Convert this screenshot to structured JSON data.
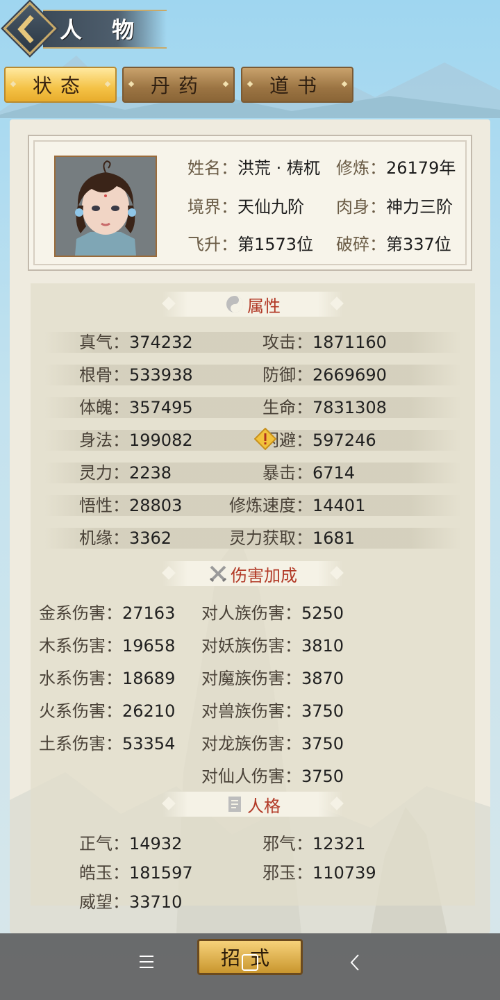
{
  "header": {
    "title": "人 物"
  },
  "tabs": [
    {
      "label": "状态",
      "active": true
    },
    {
      "label": "丹药",
      "active": false
    },
    {
      "label": "道书",
      "active": false
    }
  ],
  "profile": {
    "name_label": "姓名：",
    "name_value": "洪荒 · 梼杌",
    "cultivation_label": "修炼：",
    "cultivation_value": "26179年",
    "realm_label": "境界：",
    "realm_value": "天仙九阶",
    "body_label": "肉身：",
    "body_value": "神力三阶",
    "ascend_label": "飞升：",
    "ascend_value": "第1573位",
    "shatter_label": "破碎：",
    "shatter_value": "第337位"
  },
  "sections": {
    "attributes": "属性",
    "damage": "伤害加成",
    "personality": "人格"
  },
  "attributes": [
    {
      "l_label": "真气：",
      "l_value": "374232",
      "r_label": "攻击：",
      "r_value": "1871160"
    },
    {
      "l_label": "根骨：",
      "l_value": "533938",
      "r_label": "防御：",
      "r_value": "2669690"
    },
    {
      "l_label": "体魄：",
      "l_value": "357495",
      "r_label": "生命：",
      "r_value": "7831308"
    },
    {
      "l_label": "身法：",
      "l_value": "199082",
      "r_label": "闪避：",
      "r_value": "597246"
    },
    {
      "l_label": "灵力：",
      "l_value": "2238",
      "r_label": "暴击：",
      "r_value": "6714"
    },
    {
      "l_label": "悟性：",
      "l_value": "28803",
      "r_label": "修炼速度：",
      "r_value": "14401"
    },
    {
      "l_label": "机缘：",
      "l_value": "3362",
      "r_label": "灵力获取：",
      "r_value": "1681"
    }
  ],
  "damage": [
    {
      "l_label": "金系伤害：",
      "l_value": "27163",
      "r_label": "对人族伤害：",
      "r_value": "5250"
    },
    {
      "l_label": "木系伤害：",
      "l_value": "19658",
      "r_label": "对妖族伤害：",
      "r_value": "3810"
    },
    {
      "l_label": "水系伤害：",
      "l_value": "18689",
      "r_label": "对魔族伤害：",
      "r_value": "3870"
    },
    {
      "l_label": "火系伤害：",
      "l_value": "26210",
      "r_label": "对兽族伤害：",
      "r_value": "3750"
    },
    {
      "l_label": "土系伤害：",
      "l_value": "53354",
      "r_label": "对龙族伤害：",
      "r_value": "3750"
    },
    {
      "l_label": "",
      "l_value": "",
      "r_label": "对仙人伤害：",
      "r_value": "3750"
    }
  ],
  "personality": [
    {
      "l_label": "正气：",
      "l_value": "14932",
      "r_label": "邪气：",
      "r_value": "12321"
    },
    {
      "l_label": "皓玉：",
      "l_value": "181597",
      "r_label": "邪玉：",
      "r_value": "110739"
    },
    {
      "l_label": "威望：",
      "l_value": "33710",
      "r_label": "",
      "r_value": ""
    }
  ],
  "bottom": {
    "skill_button": "招式"
  },
  "icons": {
    "back": "chevron-left-icon",
    "attributes": "yin-yang-icon",
    "damage": "crossed-swords-icon",
    "personality": "scroll-icon",
    "warning": "warning-diamond-icon",
    "nav_menu": "menu-icon",
    "nav_home": "square-icon",
    "nav_back": "back-icon"
  },
  "colors": {
    "section_title": "#b23a27",
    "tab_active": "#f4c246",
    "tab_inactive": "#9b7443"
  }
}
